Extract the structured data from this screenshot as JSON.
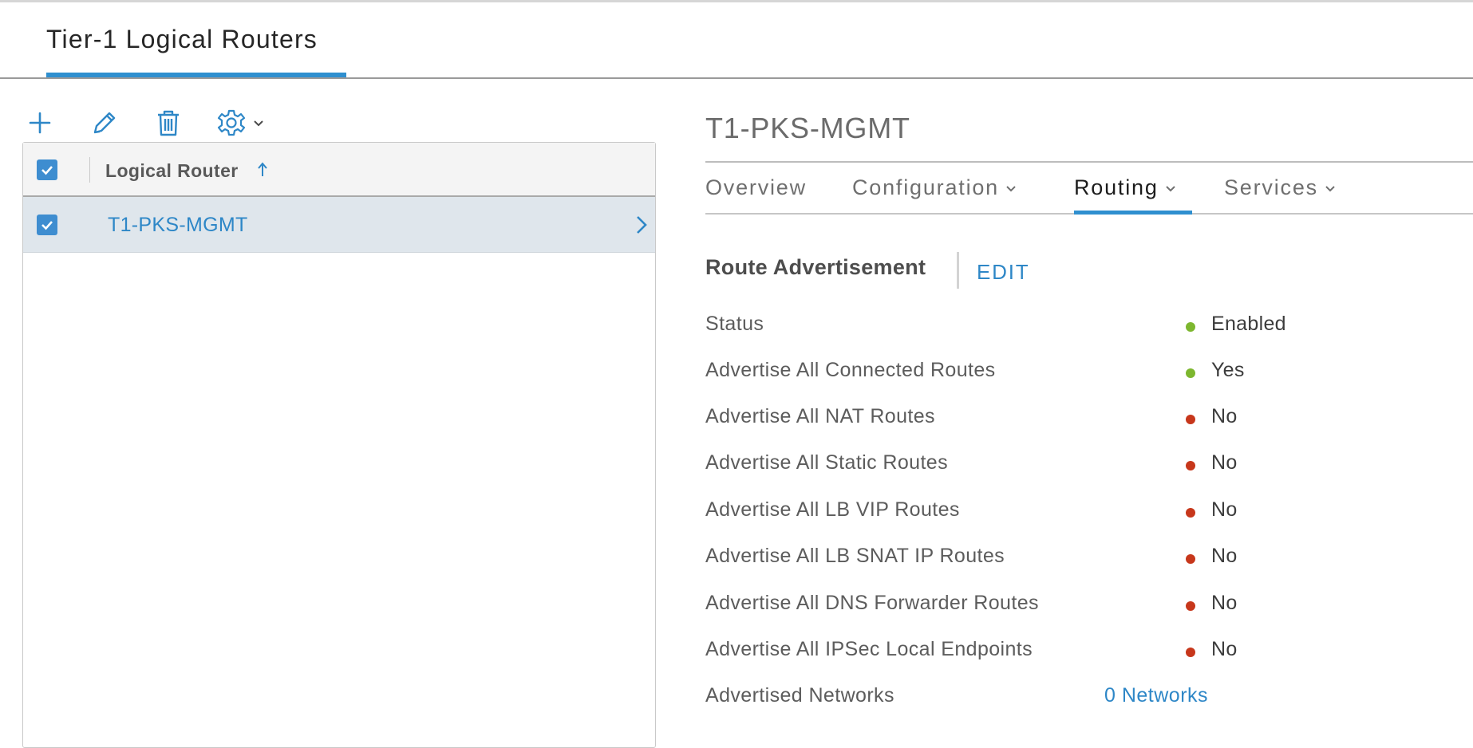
{
  "page_tab": {
    "label": "Tier-1 Logical Routers"
  },
  "toolbar": {
    "icons": [
      "plus-icon",
      "pencil-icon",
      "trash-icon",
      "gear-icon",
      "chevron-down-icon"
    ]
  },
  "grid": {
    "column_header": "Logical Router",
    "sort_direction": "ascending",
    "rows": [
      {
        "name": "T1-PKS-MGMT",
        "checked": true
      }
    ]
  },
  "detail": {
    "title": "T1-PKS-MGMT",
    "tabs": [
      {
        "label": "Overview",
        "has_menu": false,
        "active": false
      },
      {
        "label": "Configuration",
        "has_menu": true,
        "active": false
      },
      {
        "label": "Routing",
        "has_menu": true,
        "active": true
      },
      {
        "label": "Services",
        "has_menu": true,
        "active": false
      }
    ],
    "section": {
      "title": "Route Advertisement",
      "edit_label": "EDIT"
    },
    "properties": [
      {
        "label": "Status",
        "value": "Enabled",
        "status": "green"
      },
      {
        "label": "Advertise All Connected Routes",
        "value": "Yes",
        "status": "green"
      },
      {
        "label": "Advertise All NAT Routes",
        "value": "No",
        "status": "red"
      },
      {
        "label": "Advertise All Static Routes",
        "value": "No",
        "status": "red"
      },
      {
        "label": "Advertise All LB VIP Routes",
        "value": "No",
        "status": "red"
      },
      {
        "label": "Advertise All LB SNAT IP Routes",
        "value": "No",
        "status": "red"
      },
      {
        "label": "Advertise All DNS Forwarder Routes",
        "value": "No",
        "status": "red"
      },
      {
        "label": "Advertise All IPSec Local Endpoints",
        "value": "No",
        "status": "red"
      }
    ],
    "advertised_networks": {
      "label": "Advertised Networks",
      "value": "0 Networks"
    }
  },
  "colors": {
    "accent": "#2f8fcf",
    "link": "#2e87c7",
    "status_green": "#7db72f",
    "status_red": "#c7371b",
    "selected_row": "#dfe6ec"
  }
}
